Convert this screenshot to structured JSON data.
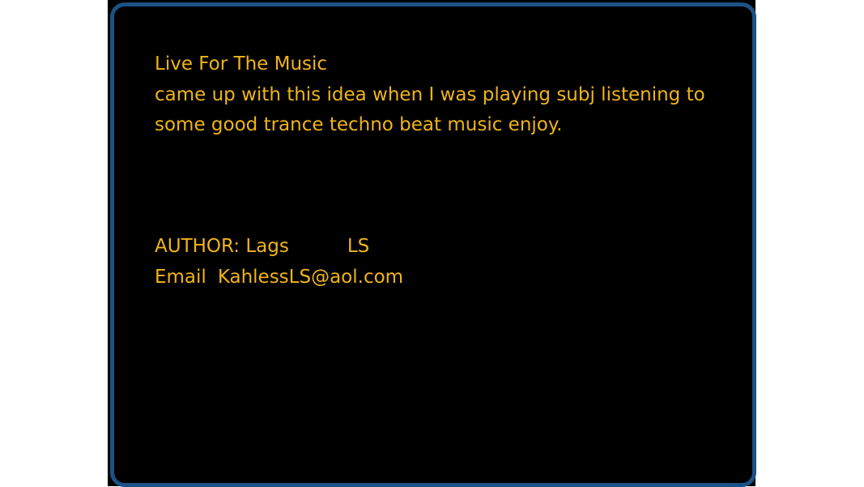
{
  "colors": {
    "background": "#000000",
    "frame_border": "#1c5285",
    "text": "#f0b419"
  },
  "content": {
    "title": "Live For The Music",
    "description_line1": "came up with this idea when I was playing subj listening to",
    "description_line2": "some good trance techno beat music enjoy."
  },
  "author": {
    "label": "AUTHOR: Lags",
    "initials": "LS",
    "email_label": "Email",
    "email_value": "KahlessLS@aol.com"
  }
}
